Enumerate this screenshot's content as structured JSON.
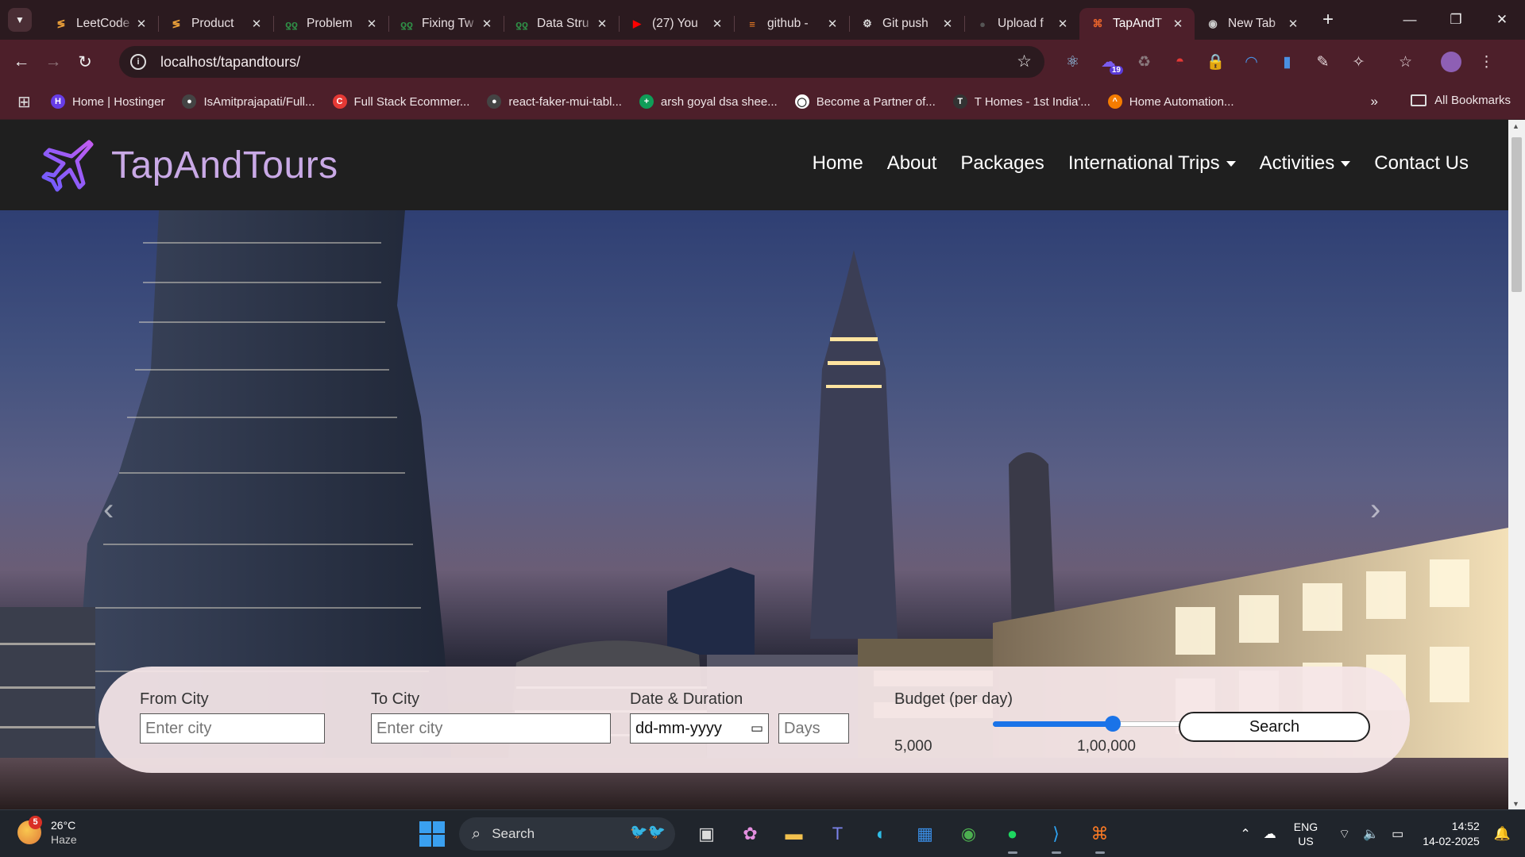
{
  "browser": {
    "tab_search_icon": "chevron-down-icon",
    "tabs": [
      {
        "title": "LeetCode",
        "favicon": "leetcode",
        "color": "#f0a33a",
        "glyph": "≶",
        "active": false
      },
      {
        "title": "Product",
        "favicon": "leetcode",
        "color": "#f0a33a",
        "glyph": "≶",
        "active": false
      },
      {
        "title": "Problem",
        "favicon": "geeksforgeeks",
        "color": "#2f8d46",
        "glyph": "ƍƍ",
        "active": false
      },
      {
        "title": "Fixing Tw",
        "favicon": "geeksforgeeks",
        "color": "#2f8d46",
        "glyph": "ƍƍ",
        "active": false
      },
      {
        "title": "Data Stru",
        "favicon": "geeksforgeeks",
        "color": "#2f8d46",
        "glyph": "ƍƍ",
        "active": false
      },
      {
        "title": "(27) You",
        "favicon": "youtube",
        "color": "#ff0000",
        "glyph": "▶",
        "active": false
      },
      {
        "title": "github -",
        "favicon": "stackoverflow",
        "color": "#f48024",
        "glyph": "≡",
        "active": false
      },
      {
        "title": "Git push",
        "favicon": "openai",
        "color": "#dddddd",
        "glyph": "⚙",
        "active": false
      },
      {
        "title": "Upload f",
        "favicon": "github",
        "color": "#555555",
        "glyph": "●",
        "active": false
      },
      {
        "title": "TapAndT",
        "favicon": "tapandtours",
        "color": "#e8632b",
        "glyph": "⌘",
        "active": true
      },
      {
        "title": "New Tab",
        "favicon": "chrome",
        "color": "#cccccc",
        "glyph": "◉",
        "active": false
      }
    ],
    "new_tab_label": "+",
    "window_controls": {
      "minimize": "—",
      "maximize": "❐",
      "close": "✕"
    },
    "nav": {
      "back": "←",
      "forward": "→",
      "reload": "↻"
    },
    "address": "localhost/tapandtours/",
    "bookmark_star": "☆",
    "extension_badge": "19",
    "bookmarks": [
      {
        "label": "Home | Hostinger",
        "color": "#673de6",
        "glyph": "H"
      },
      {
        "label": "IsAmitprajapati/Full...",
        "color": "#444444",
        "glyph": "●"
      },
      {
        "label": "Full Stack Ecommer...",
        "color": "#e53935",
        "glyph": "C"
      },
      {
        "label": "react-faker-mui-tabl...",
        "color": "#444444",
        "glyph": "●"
      },
      {
        "label": "arsh goyal dsa shee...",
        "color": "#0f9d58",
        "glyph": "+"
      },
      {
        "label": "Become a Partner of...",
        "color": "#ffffff",
        "glyph": "◯"
      },
      {
        "label": "T Homes - 1st India'...",
        "color": "#333333",
        "glyph": "T"
      },
      {
        "label": "Home Automation...",
        "color": "#f57c00",
        "glyph": "^"
      }
    ],
    "bookmarks_more": "»",
    "all_bookmarks": "All Bookmarks"
  },
  "site": {
    "brand": "TapAndTours",
    "brand_color": "#c9a9e6",
    "menu": [
      {
        "label": "Home",
        "dropdown": false
      },
      {
        "label": "About",
        "dropdown": false
      },
      {
        "label": "Packages",
        "dropdown": false
      },
      {
        "label": "International Trips",
        "dropdown": true
      },
      {
        "label": "Activities",
        "dropdown": true
      },
      {
        "label": "Contact Us",
        "dropdown": false
      }
    ],
    "carousel": {
      "prev": "‹",
      "next": "›"
    },
    "search": {
      "from_label": "From City",
      "from_placeholder": "Enter city",
      "to_label": "To City",
      "to_placeholder": "Enter city",
      "date_label": "Date & Duration",
      "date_value": "dd-mm-yyyy",
      "days_placeholder": "Days",
      "budget_label": "Budget (per day)",
      "budget_min": "5,000",
      "budget_max": "1,00,000",
      "budget_fraction": 0.5,
      "button": "Search"
    }
  },
  "taskbar": {
    "weather_badge": "5",
    "temperature": "26°C",
    "condition": "Haze",
    "search_placeholder": "Search",
    "lang_top": "ENG",
    "lang_bottom": "US",
    "time": "14:52",
    "date": "14-02-2025"
  }
}
